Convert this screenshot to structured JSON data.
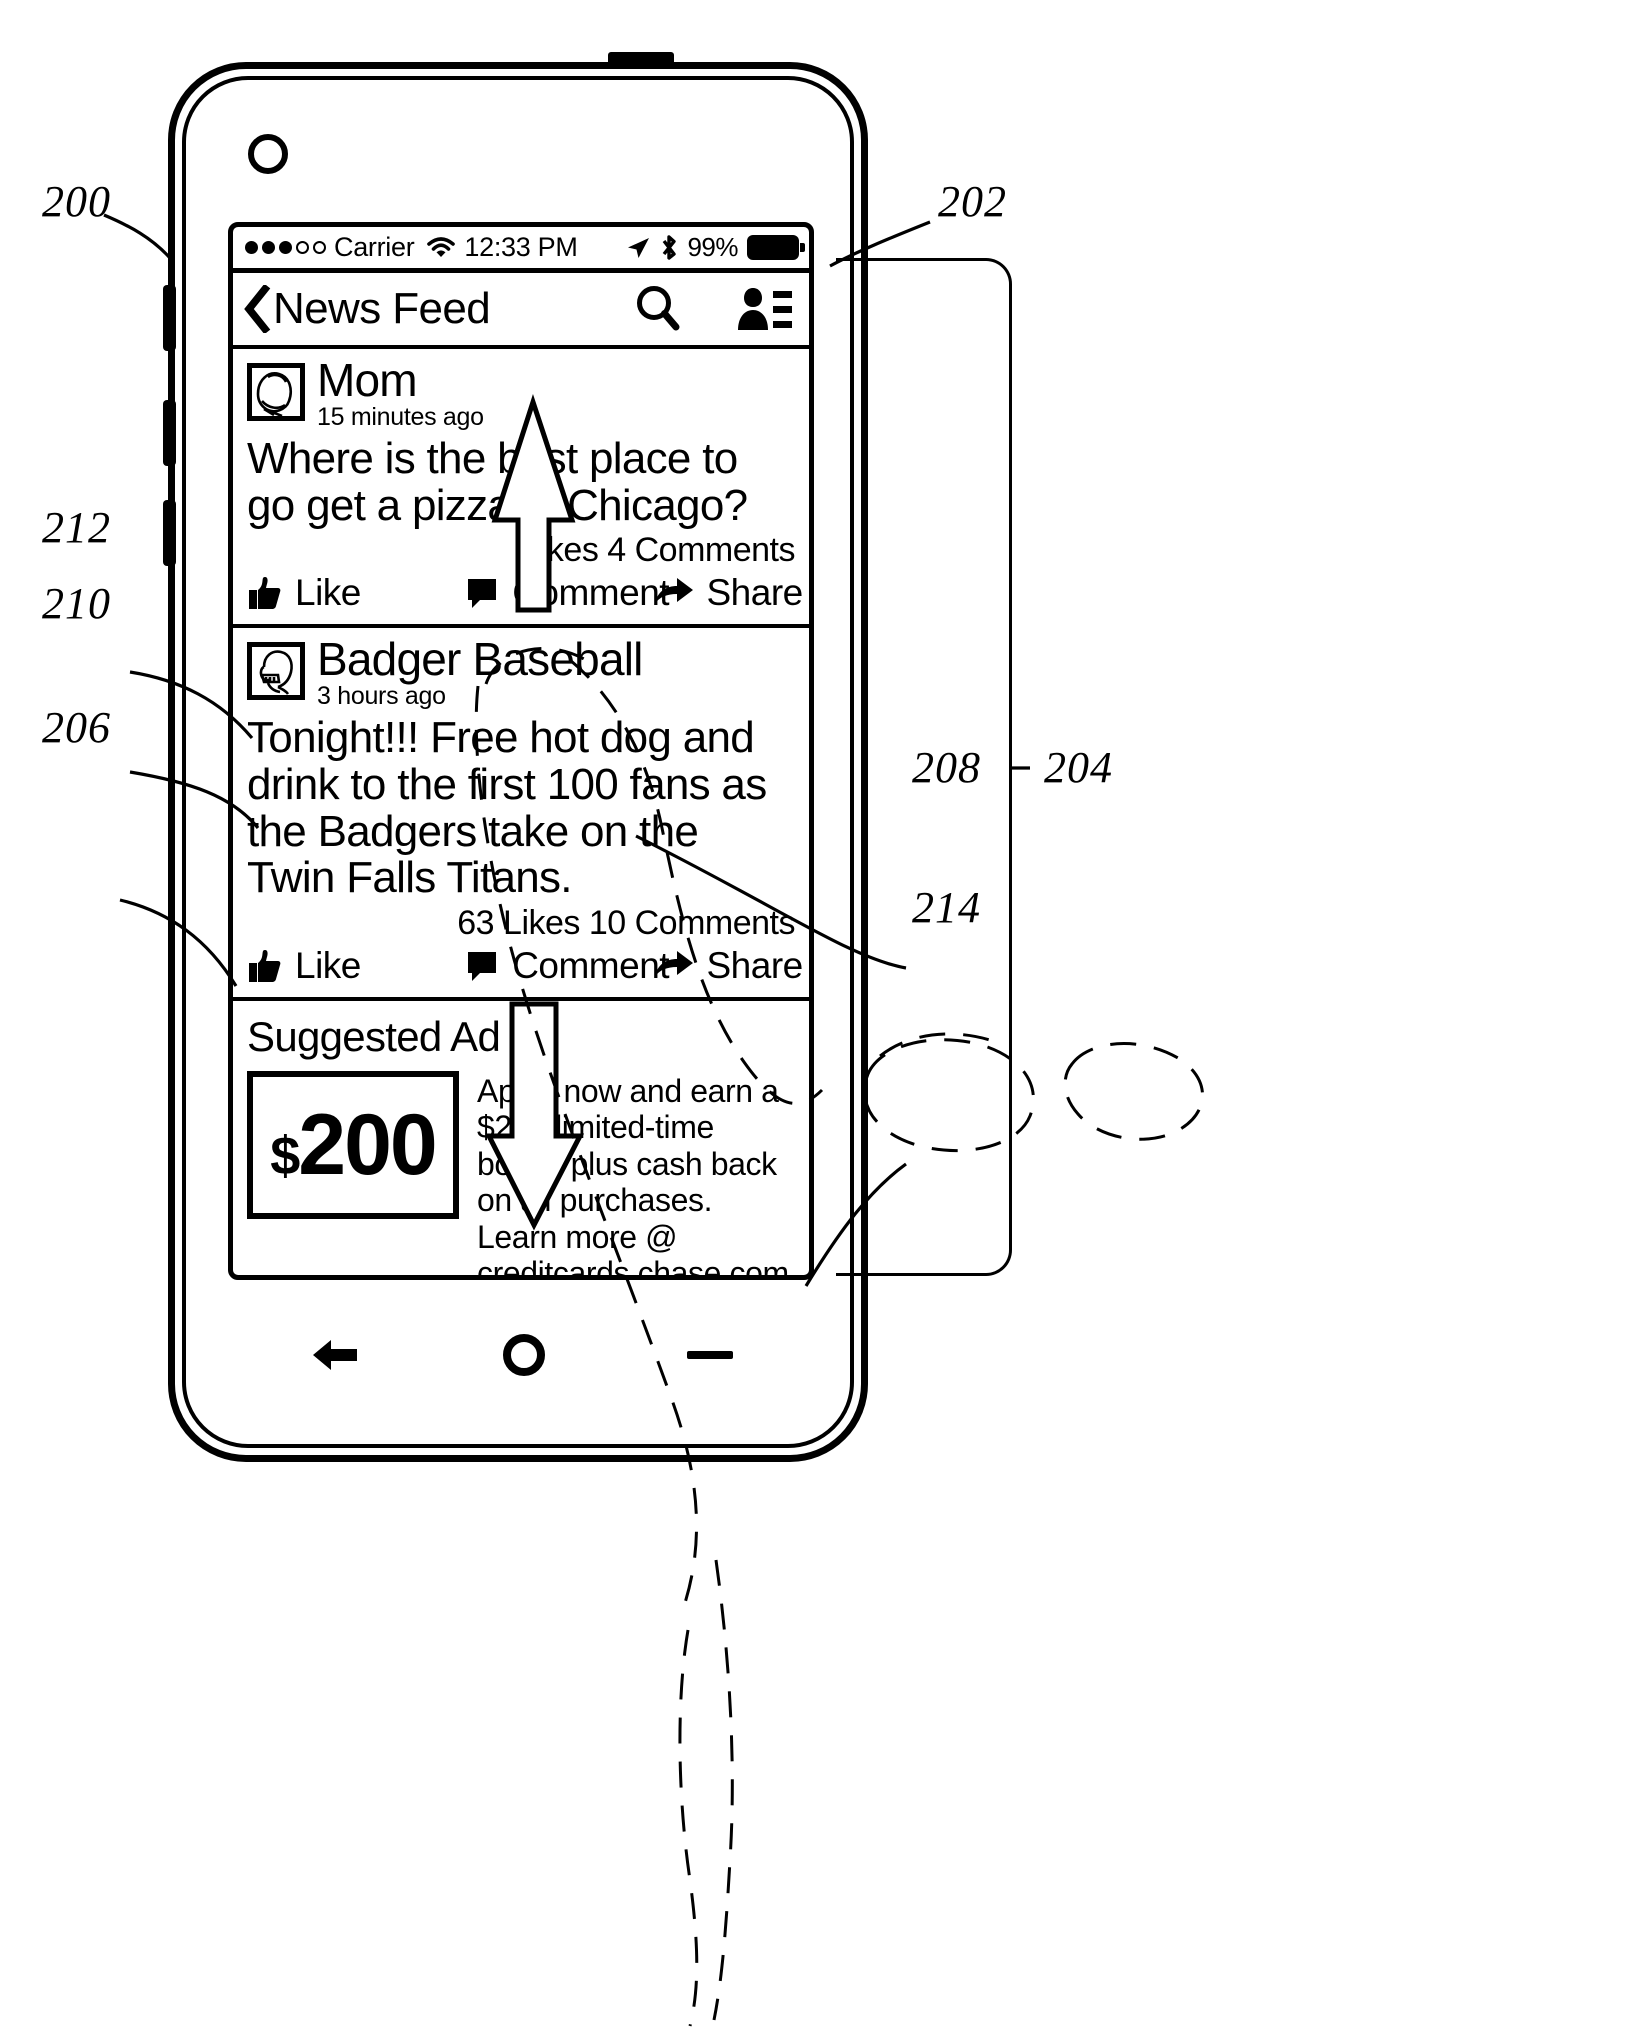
{
  "figure": {
    "reference_numerals": [
      {
        "id": "200",
        "label": "200"
      },
      {
        "id": "202",
        "label": "202"
      },
      {
        "id": "204",
        "label": "204"
      },
      {
        "id": "206",
        "label": "206"
      },
      {
        "id": "208",
        "label": "208"
      },
      {
        "id": "210",
        "label": "210"
      },
      {
        "id": "212",
        "label": "212"
      },
      {
        "id": "214",
        "label": "214"
      }
    ]
  },
  "status_bar": {
    "signal_dots": [
      true,
      true,
      true,
      false,
      false
    ],
    "carrier": "Carrier",
    "wifi_icon": "wifi-icon",
    "time": "12:33 PM",
    "location_icon": "location-arrow-icon",
    "bluetooth_icon": "bluetooth-icon",
    "battery_percent": "99%",
    "battery_icon": "battery-full-icon"
  },
  "nav_bar": {
    "back_icon": "back-chevron-icon",
    "title": "News Feed",
    "search_icon": "search-icon",
    "friends_icon": "friends-list-icon"
  },
  "posts": [
    {
      "author": "Mom",
      "timestamp": "15 minutes ago",
      "avatar_icon": "avatar-sketch-face-icon",
      "body": "Where is the best place to go get a pizza in Chicago?",
      "counts": "Likes 4 Comments",
      "actions": [
        {
          "icon": "thumbs-up-icon",
          "label": "Like"
        },
        {
          "icon": "comment-bubble-icon",
          "label": "Comment"
        },
        {
          "icon": "share-arrow-icon",
          "label": "Share"
        }
      ]
    },
    {
      "author": "Badger Baseball",
      "timestamp": "3 hours ago",
      "avatar_icon": "avatar-sketch-helmet-icon",
      "body": "Tonight!!! Free hot dog and drink to the first 100 fans as the Badgers take on the Twin Falls Titans.",
      "counts": "63 Likes 10 Comments",
      "actions": [
        {
          "icon": "thumbs-up-icon",
          "label": "Like"
        },
        {
          "icon": "comment-bubble-icon",
          "label": "Comment"
        },
        {
          "icon": "share-arrow-icon",
          "label": "Share"
        }
      ]
    }
  ],
  "ad": {
    "title": "Suggested Ad",
    "currency_symbol": "$",
    "amount": "200",
    "body": "Apply now and earn a $200 limited-time bonus plus cash back on all purchases. Learn more @ creditcards.chase.com"
  },
  "hardware_nav": {
    "back_icon": "hw-back-arrow-icon",
    "home_icon": "hw-home-circle-icon",
    "recent_icon": "hw-recent-bar-icon"
  }
}
